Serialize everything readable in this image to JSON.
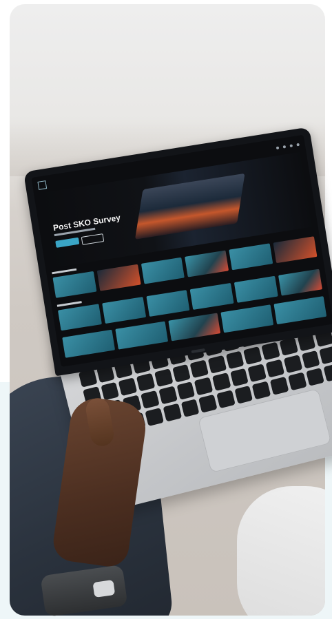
{
  "scene": {
    "description_tokens": [
      "laptop",
      "hand",
      "watch",
      "keyboard",
      "trackpad"
    ]
  },
  "screen": {
    "hero_title": "Post SKO Survey"
  },
  "colors": {
    "card_background": "#e4e1dd",
    "page_background": "#ffffff",
    "accent_teal": "#3aa5c6",
    "accent_orange": "#d2502a"
  }
}
